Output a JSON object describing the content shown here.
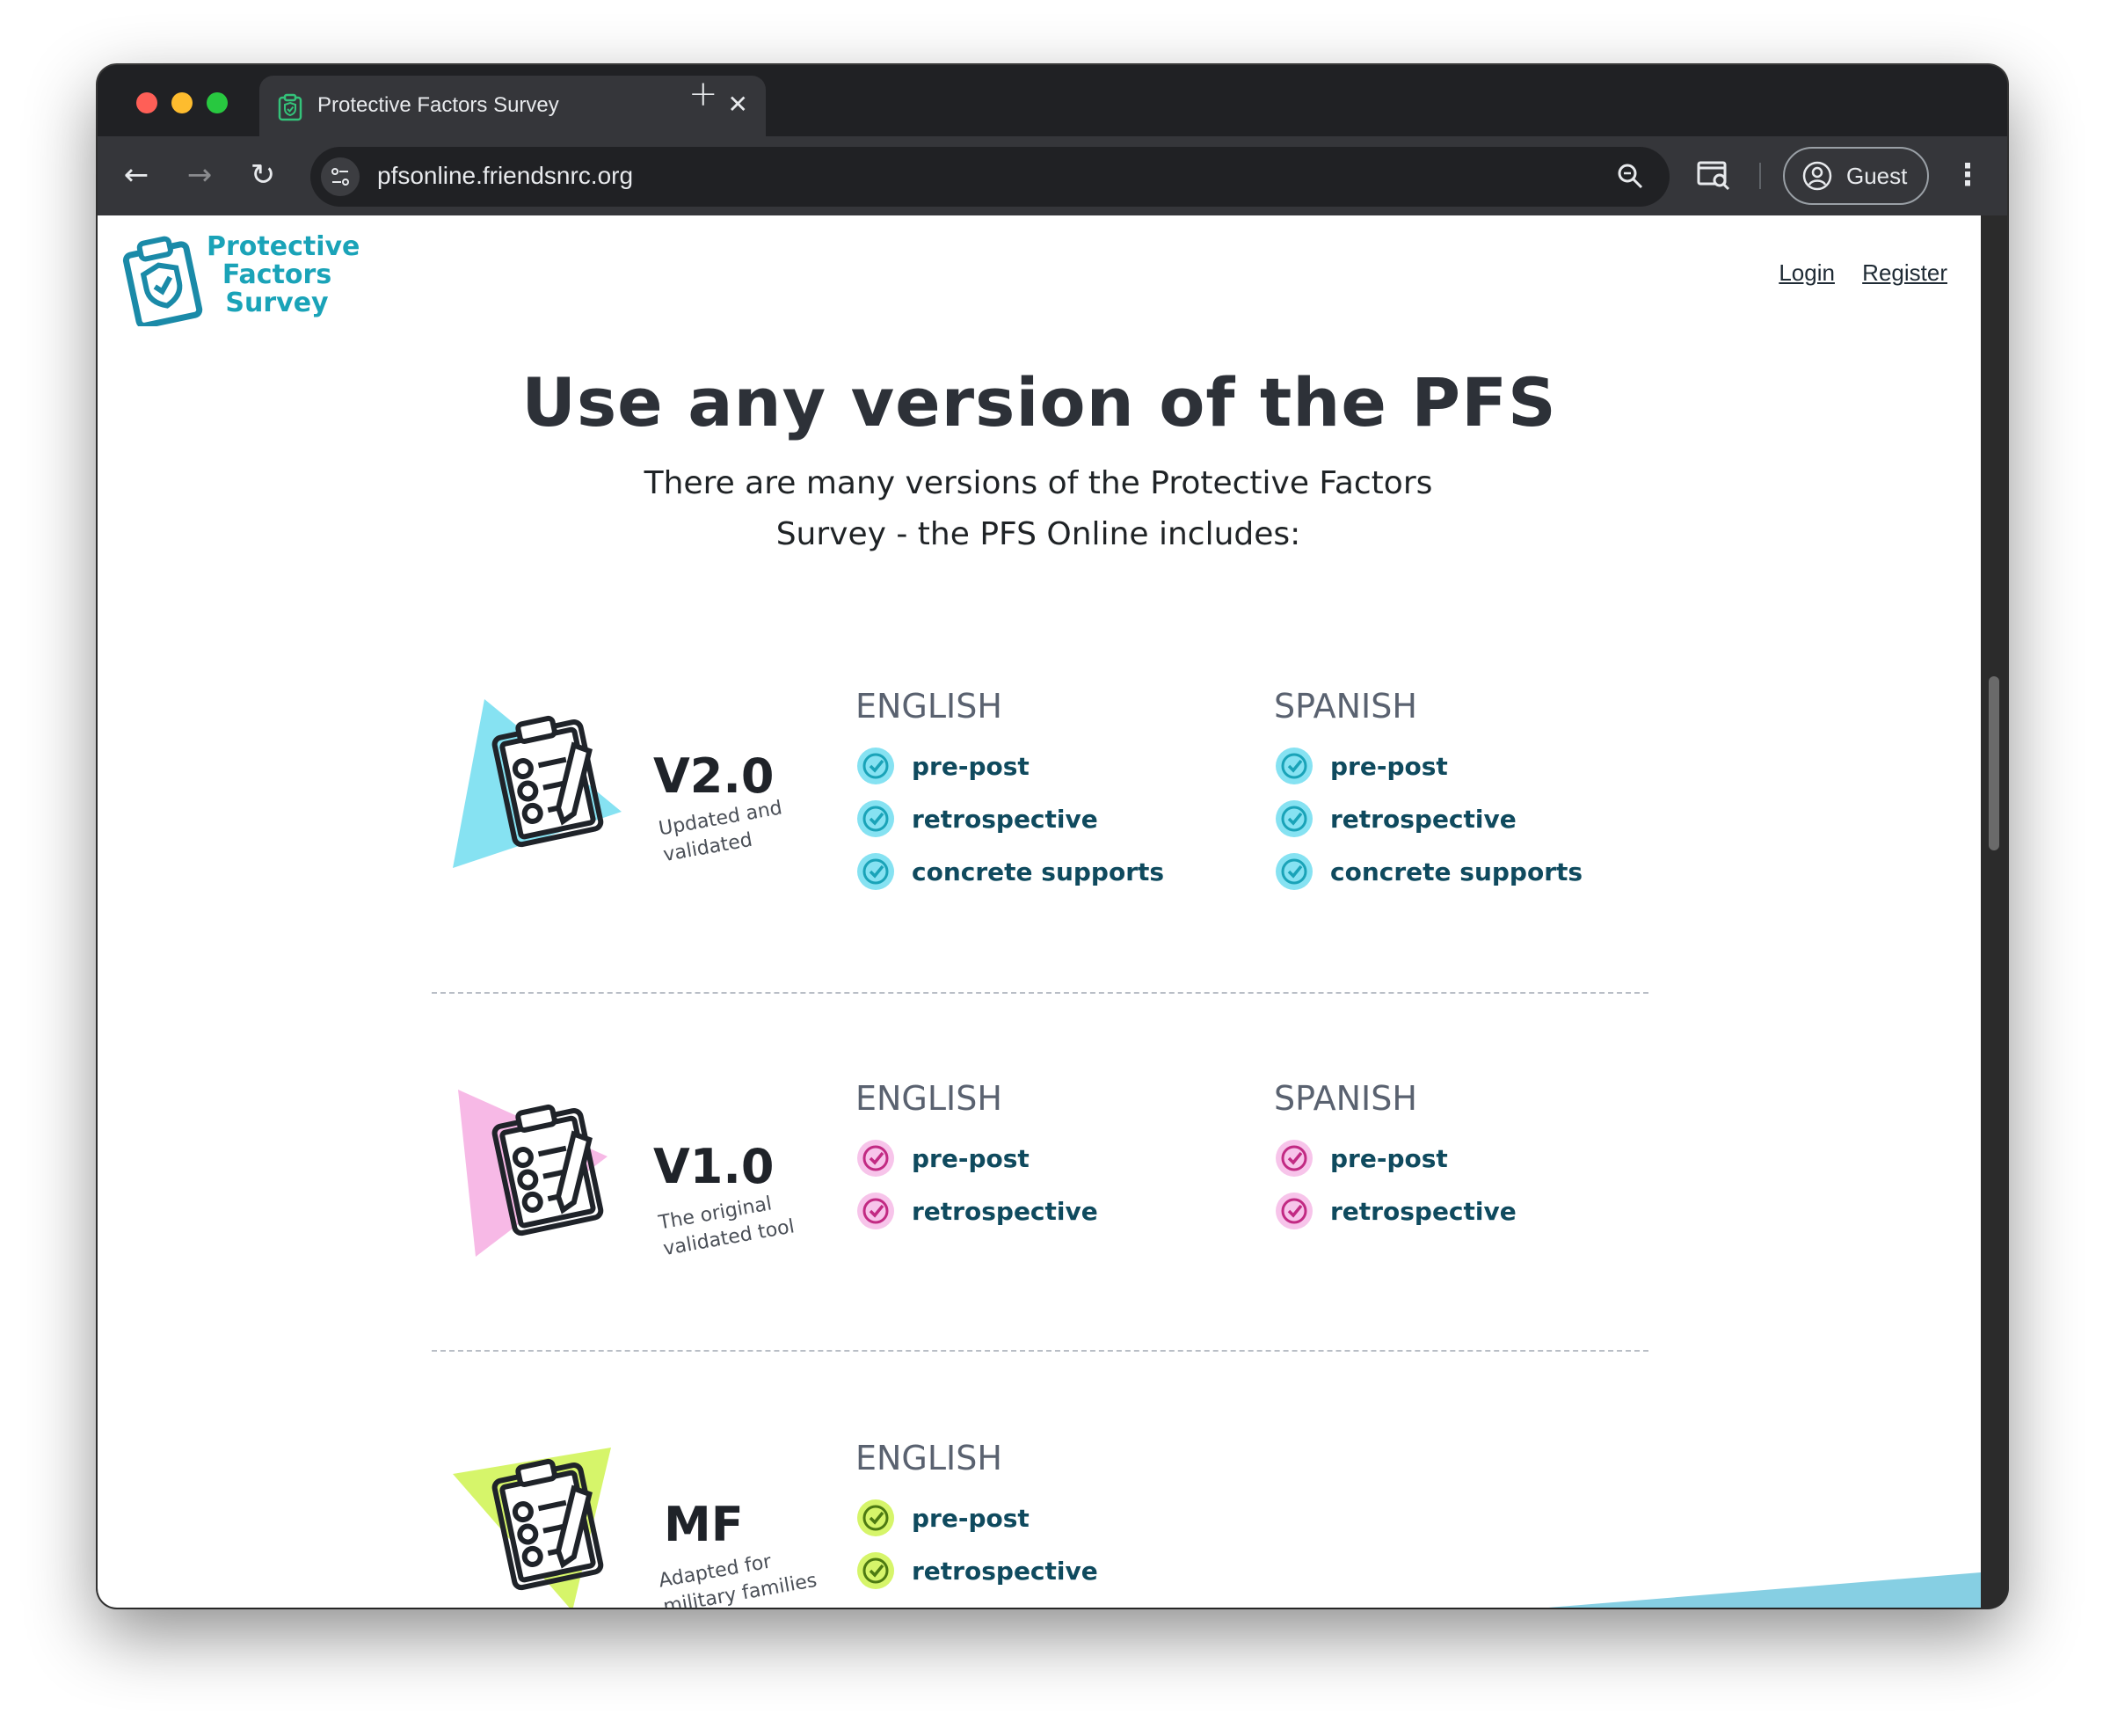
{
  "browser": {
    "tab_title": "Protective Factors Survey",
    "url": "pfsonline.friendsnrc.org",
    "profile_label": "Guest"
  },
  "site": {
    "logo_lines": [
      "Protective",
      "Factors",
      "Survey"
    ],
    "nav": {
      "login": "Login",
      "register": "Register"
    }
  },
  "hero": {
    "title": "Use any version of the PFS",
    "subtitle": "There are many versions of the Protective Factors Survey - the PFS Online includes:"
  },
  "versions": [
    {
      "name": "V2.0",
      "desc": "Updated and validated",
      "accent": "#86e2f2",
      "check_color": "#1aa3b8",
      "languages": [
        {
          "label": "ENGLISH",
          "options": [
            "pre-post",
            "retrospective",
            "concrete supports"
          ]
        },
        {
          "label": "SPANISH",
          "options": [
            "pre-post",
            "retrospective",
            "concrete supports"
          ]
        }
      ]
    },
    {
      "name": "V1.0",
      "desc": "The original validated tool",
      "accent": "#f7b9e6",
      "check_color": "#c22a83",
      "languages": [
        {
          "label": "ENGLISH",
          "options": [
            "pre-post",
            "retrospective"
          ]
        },
        {
          "label": "SPANISH",
          "options": [
            "pre-post",
            "retrospective"
          ]
        }
      ]
    },
    {
      "name": "MF",
      "desc": "Adapted for military families",
      "accent": "#d6f56a",
      "check_color": "#4d7a12",
      "languages": [
        {
          "label": "ENGLISH",
          "options": [
            "pre-post",
            "retrospective"
          ]
        }
      ]
    }
  ],
  "colors": {
    "brand_teal": "#1aa3b8",
    "heading": "#2d3138",
    "option_text": "#0f4a5e"
  }
}
